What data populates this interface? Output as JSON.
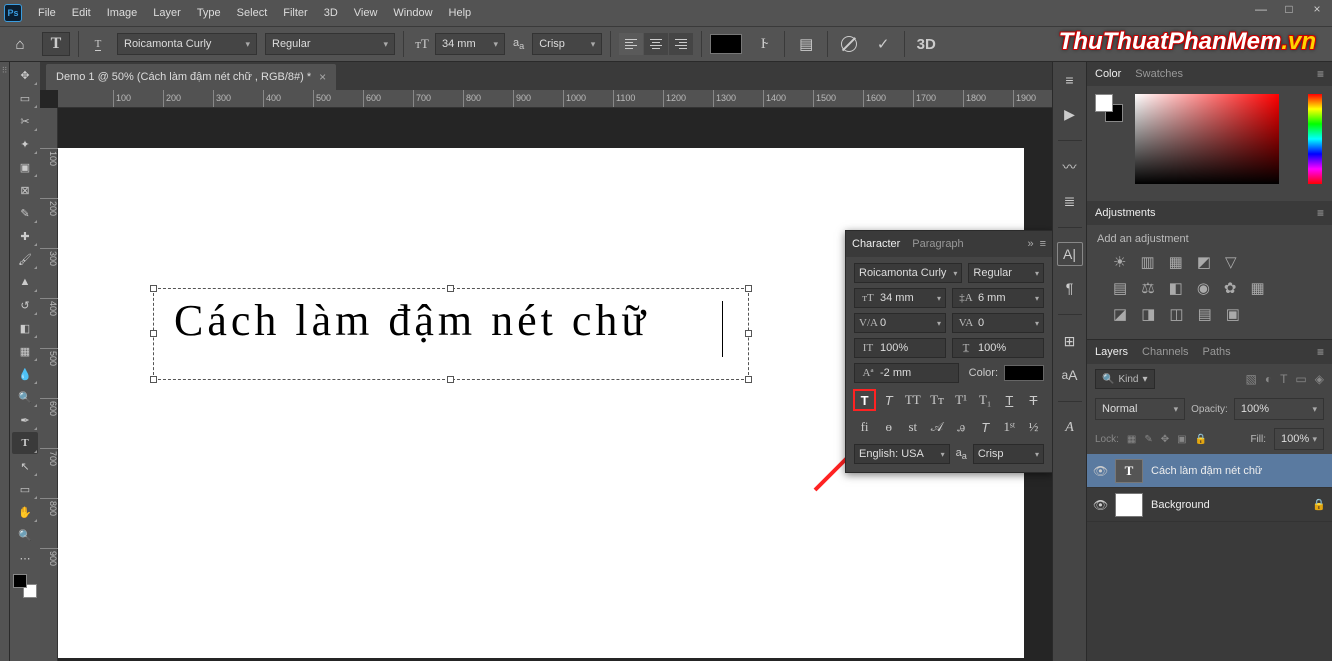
{
  "menubar": {
    "items": [
      "File",
      "Edit",
      "Image",
      "Layer",
      "Type",
      "Select",
      "Filter",
      "3D",
      "View",
      "Window",
      "Help"
    ]
  },
  "optionsbar": {
    "font_family": "Roicamonta Curly",
    "font_style": "Regular",
    "font_size": "34 mm",
    "antialias": "Crisp",
    "threeD": "3D"
  },
  "document": {
    "tab_title": "Demo 1 @ 50% (Cách làm đậm nét chữ , RGB/8#) *",
    "canvas_text": "Cách làm đậm nét chữ",
    "hruler": [
      "100",
      "200",
      "300",
      "400",
      "500",
      "600",
      "700",
      "800",
      "900",
      "1000",
      "1100",
      "1200",
      "1300",
      "1400",
      "1500",
      "1600",
      "1700",
      "1800",
      "1900"
    ],
    "vruler": [
      "100",
      "200",
      "300",
      "400",
      "500",
      "600",
      "700",
      "800",
      "900"
    ]
  },
  "charpanel": {
    "tab_character": "Character",
    "tab_paragraph": "Paragraph",
    "font_family": "Roicamonta Curly",
    "font_style": "Regular",
    "size": "34 mm",
    "leading": "6 mm",
    "kerning": "0",
    "tracking": "0",
    "vscale": "100%",
    "hscale": "100%",
    "baseline": "-2 mm",
    "color_label": "Color:",
    "language": "English: USA",
    "aa": "Crisp"
  },
  "colorpanel": {
    "tab_color": "Color",
    "tab_swatches": "Swatches"
  },
  "adjustments": {
    "title": "Adjustments",
    "add_label": "Add an adjustment"
  },
  "layers": {
    "tab_layers": "Layers",
    "tab_channels": "Channels",
    "tab_paths": "Paths",
    "kind": "Kind",
    "blend": "Normal",
    "opacity_label": "Opacity:",
    "opacity": "100%",
    "lock_label": "Lock:",
    "fill_label": "Fill:",
    "fill": "100%",
    "layer_text": "Cách làm đậm nét chữ",
    "layer_bg": "Background"
  },
  "watermark": {
    "main": "ThuThuatPhanMem",
    "suffix": ".vn"
  }
}
